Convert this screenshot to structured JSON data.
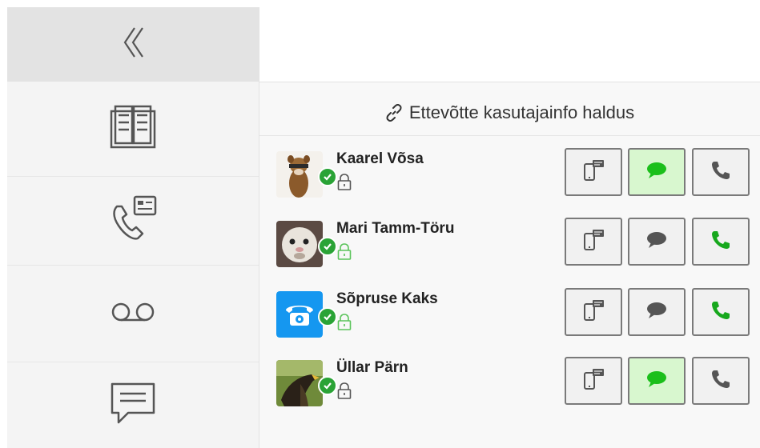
{
  "sidebar": {
    "collapse": {
      "icon": "double-chevron-left-icon"
    },
    "items": [
      {
        "name": "phonebook",
        "icon": "phonebook-icon"
      },
      {
        "name": "calls",
        "icon": "call-log-icon"
      },
      {
        "name": "voicemail",
        "icon": "voicemail-icon"
      },
      {
        "name": "messages",
        "icon": "chat-bubble-icon"
      }
    ]
  },
  "main": {
    "title": "Ettevõtte kasutajainfo haldus",
    "title_icon": "link-icon"
  },
  "contacts": [
    {
      "name": "Kaarel Võsa",
      "status": "online",
      "lock": "locked",
      "chat_active": true,
      "call_available": false
    },
    {
      "name": "Mari Tamm-Töru",
      "status": "online",
      "lock": "unlocked",
      "chat_active": false,
      "call_available": true
    },
    {
      "name": "Sõpruse Kaks",
      "status": "online",
      "lock": "unlocked",
      "chat_active": false,
      "call_available": true
    },
    {
      "name": "Üllar Pärn",
      "status": "online",
      "lock": "locked",
      "chat_active": true,
      "call_available": false
    }
  ],
  "colors": {
    "presence_online": "#2aa336",
    "chat_active": "#1bbf1b",
    "call_available": "#17a81d",
    "icon_gray": "#555555",
    "unlocked_green": "#5bc45b",
    "avatar_phone_bg": "#1597f0"
  }
}
